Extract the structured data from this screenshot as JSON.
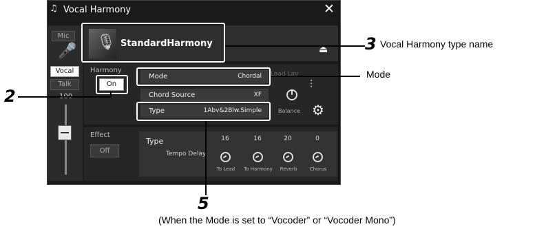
{
  "window": {
    "title": "Vocal Harmony",
    "close_label": "✕"
  },
  "left": {
    "mic_label": "Mic",
    "vocal_label": "Vocal",
    "talk_label": "Talk",
    "volume": "100"
  },
  "type": {
    "name": "StandardHarmony"
  },
  "harmony": {
    "label": "Harmony",
    "state": "On",
    "mode_key": "Mode",
    "mode_value": "Chordal",
    "source_key": "Chord Source",
    "source_value": "XF",
    "type_key": "Type",
    "type_value": "1Abv&2Blw.Simple",
    "faded_text": "Lead Lay",
    "balance_label": "Balance"
  },
  "effect": {
    "label": "Effect",
    "state": "Off",
    "type_label": "Type",
    "type_value": "Tempo Delay",
    "knobs": [
      {
        "value": "16",
        "label": "To Lead"
      },
      {
        "value": "16",
        "label": "To Harmony"
      },
      {
        "value": "20",
        "label": "Reverb"
      },
      {
        "value": "0",
        "label": "Chorus"
      }
    ]
  },
  "callouts": {
    "n2": "2",
    "n3": "3",
    "n3_text": "Vocal Harmony type name",
    "mode_text": "Mode",
    "n5": "5",
    "n5_text": "(When the Mode is set to “Vocoder” or “Vocoder Mono”)"
  }
}
